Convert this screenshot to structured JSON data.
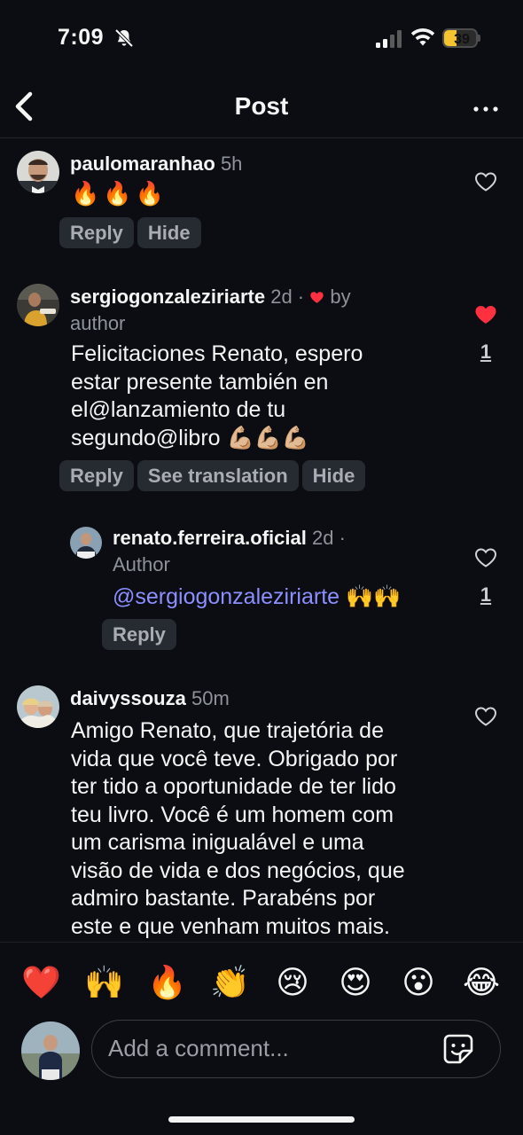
{
  "status_bar": {
    "time": "7:09",
    "battery": "39",
    "battery_level": 0.39
  },
  "nav": {
    "title": "Post"
  },
  "comments": [
    {
      "username": "paulomaranhao",
      "time": "5h",
      "text": "🔥🔥🔥",
      "actions": [
        "Reply",
        "Hide"
      ]
    },
    {
      "username": "sergiogonzaleziriarte",
      "time": "2d ·",
      "liked_by": "by",
      "liked_by_line2": "author",
      "text_lines": [
        "Felicitaciones Renato, espero",
        "estar presente también en",
        "el@lanzamiento de tu",
        "segundo@libro 💪🏼💪🏼💪🏼"
      ],
      "actions": [
        "Reply",
        "See translation",
        "Hide"
      ],
      "likes": "1"
    },
    {
      "username": "renato.ferreira.oficial",
      "time": "2d ·",
      "badge": "Author",
      "mention": "@sergiogonzaleziriarte",
      "emoji": "🙌🙌",
      "actions": [
        "Reply"
      ],
      "likes": "1"
    },
    {
      "username": "daivyssouza",
      "time": "50m",
      "text_lines": [
        "Amigo Renato, que trajetória de",
        "vida que você teve. Obrigado por",
        "ter tido a oportunidade de ter lido",
        "teu livro. Você é um homem com",
        "um carisma inigualável e uma",
        "visão de vida e dos negócios, que",
        "admiro bastante. Parabéns por",
        "este e que venham muitos mais."
      ]
    }
  ],
  "reactions": [
    "❤️",
    "🙌",
    "🔥",
    "👏",
    "😢",
    "😍",
    "😮",
    "😂"
  ],
  "composer": {
    "placeholder": "Add a comment..."
  },
  "icons": {
    "back": "chevron-left-icon",
    "more": "more-horizontal-icon",
    "like": "heart-outline-icon",
    "liked": "heart-filled-icon",
    "sticker": "sticker-icon",
    "silent": "bell-slash-icon"
  },
  "colors": {
    "like_red": "#ff3040",
    "mention": "#8c8fff",
    "battery": "#f4c430"
  }
}
